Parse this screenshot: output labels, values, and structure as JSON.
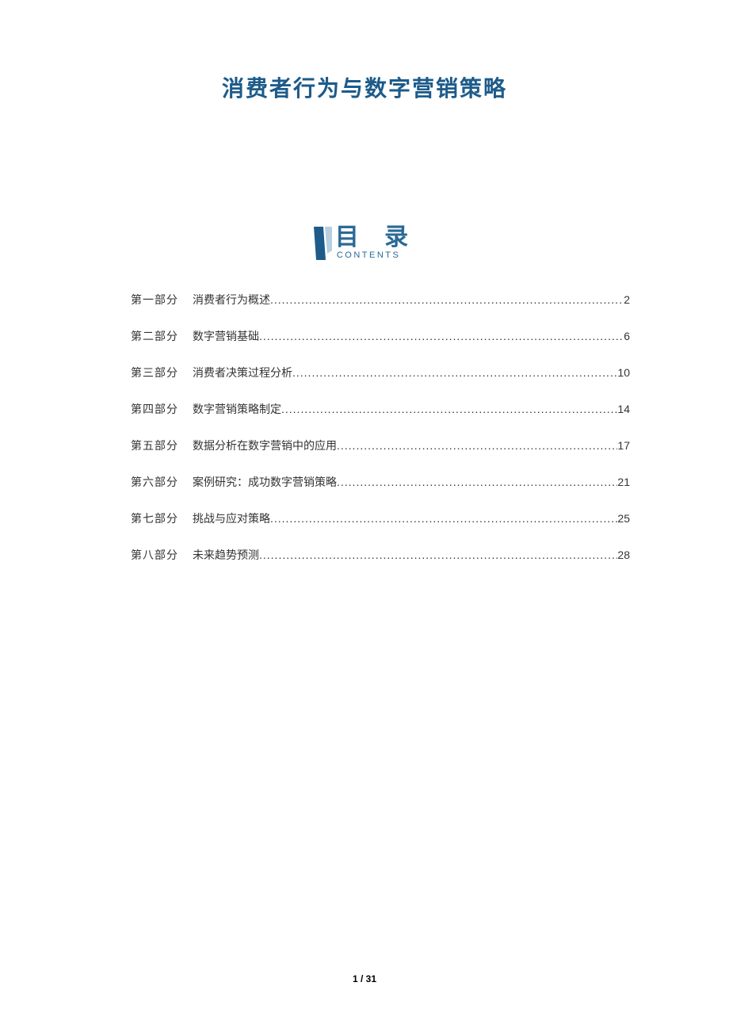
{
  "title": "消费者行为与数字营销策略",
  "toc_header": {
    "label_cn": "目 录",
    "label_en": "CONTENTS"
  },
  "toc": [
    {
      "part": "第一部分",
      "text": "消费者行为概述",
      "page": "2"
    },
    {
      "part": "第二部分",
      "text": "数字营销基础",
      "page": "6"
    },
    {
      "part": "第三部分",
      "text": "消费者决策过程分析",
      "page": "10"
    },
    {
      "part": "第四部分",
      "text": "数字营销策略制定",
      "page": "14"
    },
    {
      "part": "第五部分",
      "text": "数据分析在数字营销中的应用",
      "page": "17"
    },
    {
      "part": "第六部分",
      "text": "案例研究：成功数字营销策略",
      "page": "21"
    },
    {
      "part": "第七部分",
      "text": "挑战与应对策略",
      "page": "25"
    },
    {
      "part": "第八部分",
      "text": "未来趋势预测",
      "page": "28"
    }
  ],
  "footer": {
    "current": "1",
    "sep": " / ",
    "total": "31"
  }
}
